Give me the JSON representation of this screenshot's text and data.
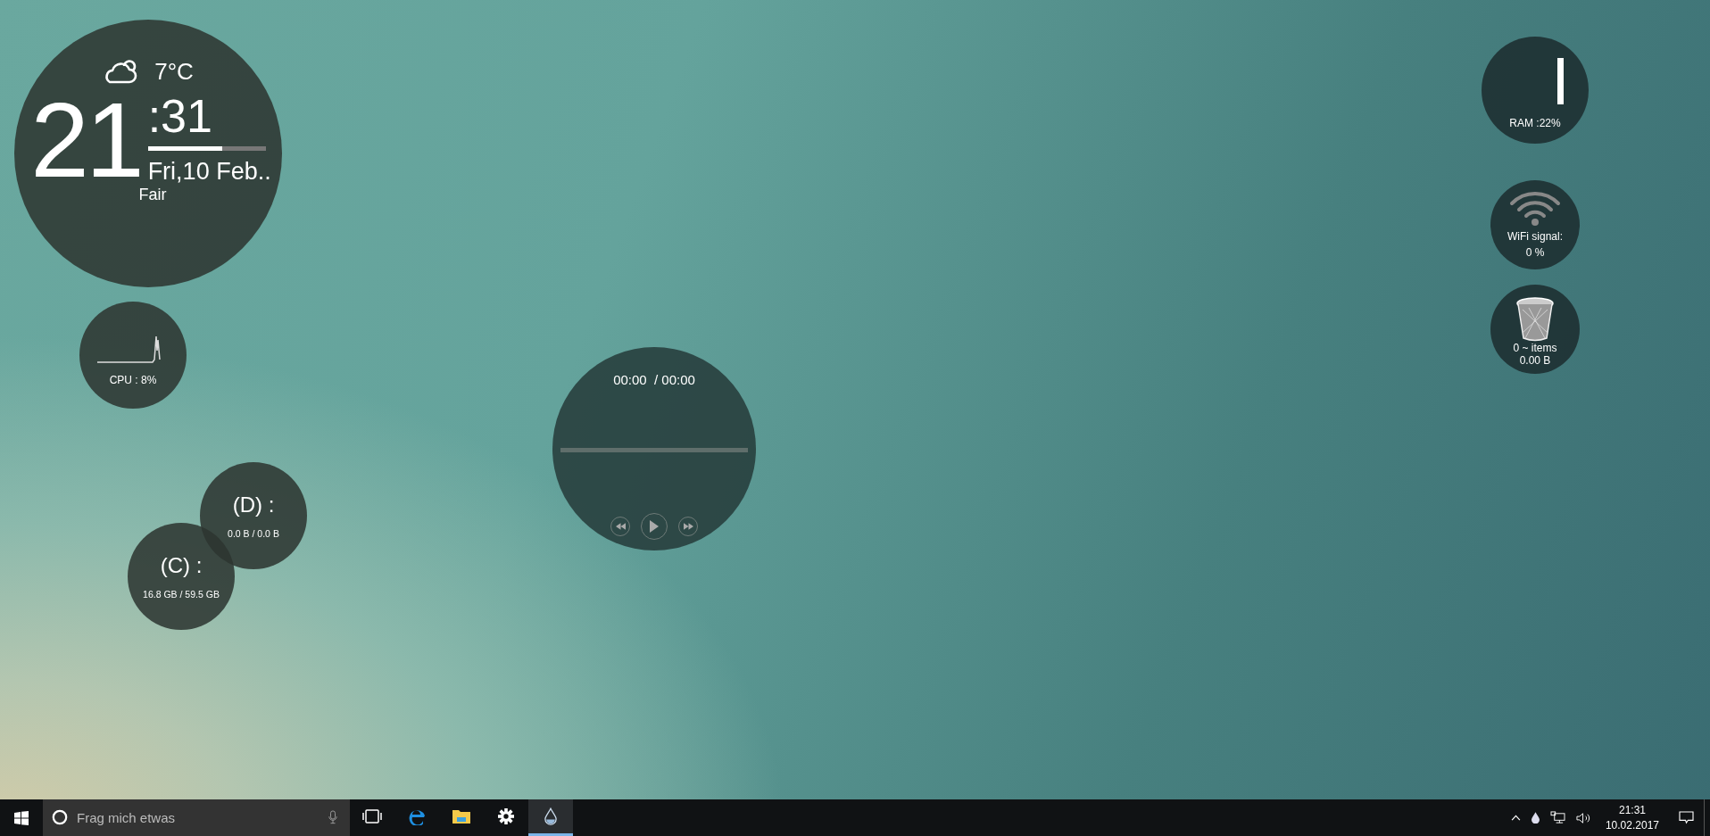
{
  "clock": {
    "temperature": "7°C",
    "hour": "21",
    "minute": ":31",
    "seconds_progress": {
      "level": 0.63
    },
    "date": "Fri,10 Feb..",
    "condition": "Fair"
  },
  "cpu": {
    "label": "CPU : 8%"
  },
  "drives": [
    {
      "label": "(D) :",
      "usage": "0.0 B / 0.0 B"
    },
    {
      "label": "(C) :",
      "usage": "16.8 GB / 59.5 GB"
    }
  ],
  "player": {
    "time": "00:00  / 00:00"
  },
  "ram": {
    "label": "RAM :22%"
  },
  "wifi": {
    "label": "WiFi signal:",
    "value": "0 %"
  },
  "recycle_bin": {
    "items": "0 ~ items",
    "size": "0.00 B"
  },
  "taskbar": {
    "search": {
      "placeholder": "Frag mich etwas"
    },
    "apps": [
      {
        "kind": "taskview",
        "selected": false
      },
      {
        "kind": "edge",
        "selected": false
      },
      {
        "kind": "explorer",
        "selected": false
      },
      {
        "kind": "settings",
        "selected": false
      },
      {
        "kind": "drop",
        "selected": true
      }
    ],
    "tray": {
      "time": "21:31",
      "date": "10.02.2017"
    }
  }
}
